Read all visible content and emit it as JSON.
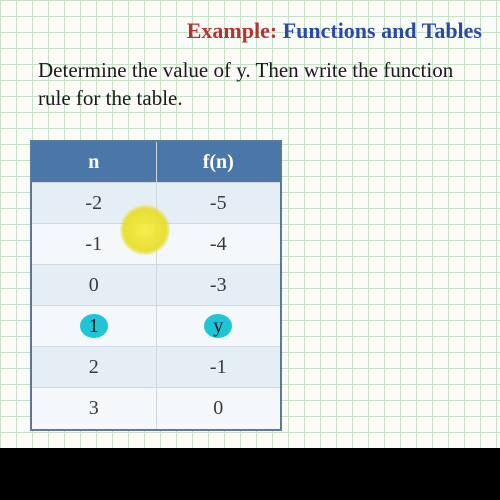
{
  "title": {
    "example_label": "Example:",
    "rest": "Functions and Tables"
  },
  "instruction": "Determine the value of y.  Then write the function rule for the table.",
  "table": {
    "header_left": "n",
    "header_right": "f(n)",
    "rows": [
      {
        "n": "-2",
        "fn": "-5"
      },
      {
        "n": "-1",
        "fn": "-4"
      },
      {
        "n": "0",
        "fn": "-3"
      },
      {
        "n": "1",
        "fn": "y"
      },
      {
        "n": "2",
        "fn": "-1"
      },
      {
        "n": "3",
        "fn": "0"
      }
    ]
  },
  "chart_data": {
    "type": "table",
    "title": "Functions and Tables",
    "columns": [
      "n",
      "f(n)"
    ],
    "rows": [
      [
        -2,
        -5
      ],
      [
        -1,
        -4
      ],
      [
        0,
        -3
      ],
      [
        1,
        "y"
      ],
      [
        2,
        -1
      ],
      [
        3,
        0
      ]
    ],
    "highlighted_row_index": 3,
    "unknown_variable": "y"
  }
}
